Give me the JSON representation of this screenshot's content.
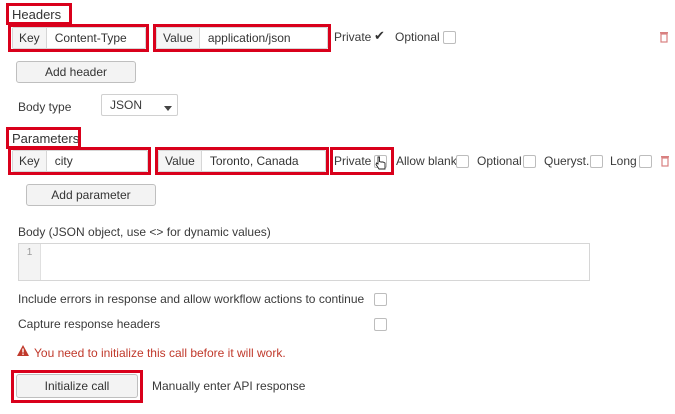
{
  "headers": {
    "title": "Headers",
    "key_label": "Key",
    "key_value": "Content-Type",
    "value_label": "Value",
    "value_value": "application/json",
    "private_label": "Private",
    "private_checked": true,
    "optional_label": "Optional",
    "optional_checked": false,
    "add_label": "Add header"
  },
  "body_type": {
    "label": "Body type",
    "selected": "JSON"
  },
  "parameters": {
    "title": "Parameters",
    "key_label": "Key",
    "key_value": "city",
    "value_label": "Value",
    "value_value": "Toronto, Canada",
    "private_label": "Private",
    "allow_blank_label": "Allow blank",
    "optional_label": "Optional",
    "querystring_label": "Queryst.",
    "long_label": "Long",
    "add_label": "Add parameter"
  },
  "body": {
    "label": "Body (JSON object, use <> for dynamic values)",
    "line_number": "1",
    "value": ""
  },
  "options": {
    "include_errors_label": "Include errors in response and allow workflow actions to continue",
    "capture_headers_label": "Capture response headers"
  },
  "warning": {
    "text": "You need to initialize this call before it will work.",
    "color": "#c0392b"
  },
  "actions": {
    "initialize_label": "Initialize call",
    "manual_label": "Manually enter API response"
  },
  "colors": {
    "highlight": "#d9001b",
    "field_label_bg": "#f5f5f5",
    "border": "#d6d6d6"
  }
}
